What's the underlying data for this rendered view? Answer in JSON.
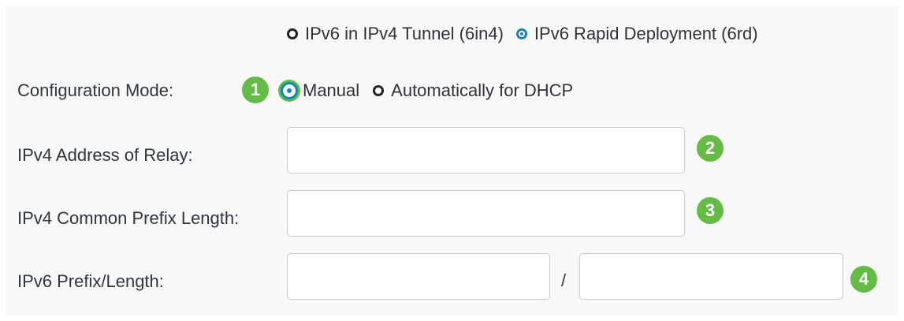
{
  "tunnel_type": {
    "options": [
      {
        "label": "IPv6 in IPv4 Tunnel (6in4)",
        "selected": false
      },
      {
        "label": "IPv6 Rapid Deployment (6rd)",
        "selected": true
      }
    ]
  },
  "config_mode": {
    "label": "Configuration Mode:",
    "badge": "1",
    "options": [
      {
        "label": "Manual",
        "selected": true
      },
      {
        "label": "Automatically for DHCP",
        "selected": false
      }
    ]
  },
  "relay": {
    "label": "IPv4 Address of Relay:",
    "value": "",
    "badge": "2"
  },
  "common_prefix": {
    "label": "IPv4 Common Prefix Length:",
    "value": "",
    "badge": "3"
  },
  "ipv6_prefix": {
    "label": "IPv6 Prefix/Length:",
    "prefix_value": "",
    "separator": "/",
    "length_value": "",
    "badge": "4"
  },
  "colors": {
    "badge_green": "#64bb46",
    "radio_blue": "#1783b9",
    "panel_bg": "#f8f8f8"
  },
  "icons": [
    "radio-unselected-icon",
    "radio-selected-icon",
    "step-badge-icon"
  ]
}
